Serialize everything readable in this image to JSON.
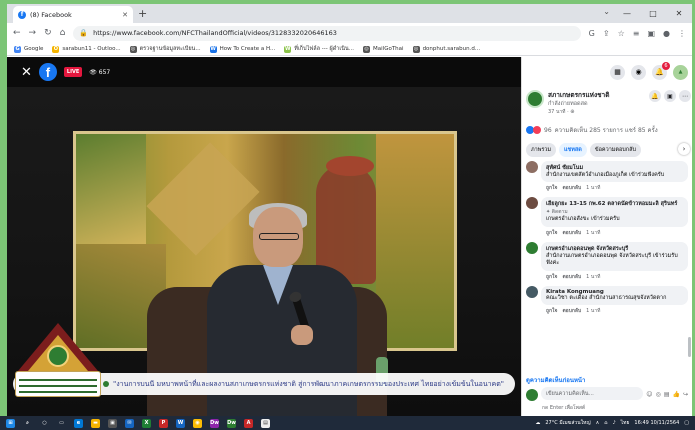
{
  "browser": {
    "tab_title": "(8) Facebook",
    "url": "https://www.facebook.com/NFCThailandOfficial/videos/3128332020646163",
    "window_controls": [
      "—",
      "□",
      "✕"
    ]
  },
  "bookmarks": [
    {
      "label": "Google",
      "color": "#4285f4",
      "glyph": "G"
    },
    {
      "label": "sarabun11 - Outloo...",
      "color": "#f4b400",
      "glyph": "O"
    },
    {
      "label": "ตรวจฐานข้อมูลทะเบียน...",
      "color": "#555555",
      "glyph": "◎"
    },
    {
      "label": "How To Create a H...",
      "color": "#1a73e8",
      "glyph": "W"
    },
    {
      "label": "ที่เก็บไฟล์ล --- ผู้ดำเนิน...",
      "color": "#8bc34a",
      "glyph": "W"
    },
    {
      "label": "MailGoThai",
      "color": "#555555",
      "glyph": "◎"
    },
    {
      "label": "donphut.sarabun.d...",
      "color": "#555555",
      "glyph": "◎"
    }
  ],
  "video": {
    "live_badge": "LIVE",
    "viewer_count": "657",
    "caption": "\"งานการบนนี มหบาพหน้าที่และผลงานสภาเกษตรกรแห่งชาติ สู่การพัฒนาภาคเกษตรกรรมของประเทศ ไทยอย่างเข้มข้นในอนาคต\""
  },
  "sidebar": {
    "notification_count": "6",
    "page_name": "สภาเกษตรกรแห่งชาติ",
    "page_status": "กำลังถ่ายทอดสด",
    "page_time": "37 นาที · ⊕",
    "reaction_count": "96",
    "stats": "ความคิดเห็น 285 รายการ  แชร์ 85 ครั้ง",
    "chips": [
      "ภาพรวม",
      "แชทสด",
      "ข้อความตอบกลับ"
    ],
    "comments": [
      {
        "name": "สุทัศน์ ชัยมโนม",
        "badge": "",
        "text": "สำนักงานเขตสัตว์อำเภอเมืองภูเก็ต เข้าร่วมฟังครับ",
        "like": "ถูกใจ",
        "reply": "ตอบกลับ",
        "time": "1 นาที",
        "color": "#8d6e63"
      },
      {
        "name": "เฮียลูกยะ 13-15 กพ.62 ตลาดนัดข้าวหอมมะลิ สุรินทร์",
        "badge": "ติดตาม",
        "text": "เกษตรอำเภอสังขะ เข้าร่วมครับ",
        "like": "ถูกใจ",
        "reply": "ตอบกลับ",
        "time": "1 นาที",
        "color": "#6d4c41"
      },
      {
        "name": "เกษตรอำเภอดอนพุด จังหวัดสระบุรี",
        "badge": "",
        "text": "สำนักงานเกษตรอำเภอดอนพุด จังหวัดสระบุรี เข้าร่วมรับฟังค่ะ",
        "like": "ถูกใจ",
        "reply": "ตอบกลับ",
        "time": "1 นาที",
        "color": "#2e7d32"
      },
      {
        "name": "Kirata Kongmuang",
        "badge": "",
        "text": "คณะวิชา ตะเดือง สำนักงานสาธารณสุขจังหวัดตาก",
        "like": "ถูกใจ",
        "reply": "ตอบกลับ",
        "time": "1 นาที",
        "color": "#455a64"
      }
    ],
    "more_comments": "ดูความคิดเห็นก่อนหน้า",
    "composer_placeholder": "เขียนความคิดเห็น...",
    "composer_hint": "กด Enter เพื่อโพสต์"
  },
  "taskbar": {
    "weather": "27°C มีเมฆส่วนใหญ่",
    "lang": "ไทย",
    "time": "16:49",
    "date": "10/11/2564"
  }
}
